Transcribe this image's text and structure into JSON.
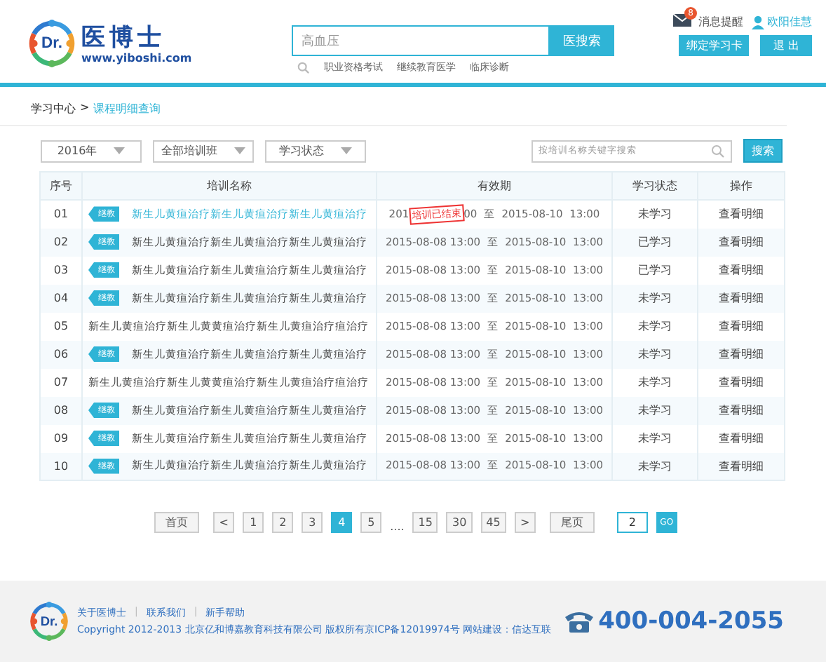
{
  "header": {
    "logo_mark": "Dr.",
    "logo_title": "医博士",
    "logo_url": "www.yiboshi.com",
    "search": {
      "value": "高血压",
      "button": "医搜索",
      "hot_words": [
        "职业资格考试",
        "继续教育医学",
        "临床诊断"
      ]
    },
    "messages": {
      "label": "消息提醒",
      "badge": "8"
    },
    "user": "欧阳佳慧",
    "bind_button": "绑定学习卡",
    "logout_button": "退 出"
  },
  "breadcrumb": {
    "root": "学习中心",
    "sep": ">",
    "current": "课程明细查询"
  },
  "filters": [
    {
      "label": "2016年"
    },
    {
      "label": "全部培训班"
    },
    {
      "label": "学习状态"
    }
  ],
  "keyword_search": {
    "placeholder": "按培训名称关键字搜索",
    "button": "搜索"
  },
  "table": {
    "columns": [
      "序号",
      "培训名称",
      "有效期",
      "学习状态",
      "操作"
    ],
    "rows": [
      {
        "no": "01",
        "tag": "继教",
        "name": "新生儿黄疸治疗新生儿黄疸治疗新生儿黄疸治疗",
        "selected": true,
        "valid_from": "201",
        "stamp": "培训已结束",
        "valid_from_rest": "00",
        "to": "至",
        "valid_until": "2015-08-10  13:00",
        "status": "未学习",
        "action": "查看明细"
      },
      {
        "no": "02",
        "tag": "继教",
        "name": "新生儿黄疸治疗新生儿黄疸治疗新生儿黄疸治疗",
        "selected": false,
        "valid_from": "2015-08-08  13:00",
        "to": "至",
        "valid_until": "2015-08-10  13:00",
        "status": "已学习",
        "action": "查看明细"
      },
      {
        "no": "03",
        "tag": "继教",
        "name": "新生儿黄疸治疗新生儿黄疸治疗新生儿黄疸治疗",
        "selected": false,
        "valid_from": "2015-08-08  13:00",
        "to": "至",
        "valid_until": "2015-08-10  13:00",
        "status": "已学习",
        "action": "查看明细"
      },
      {
        "no": "04",
        "tag": "继教",
        "name": "新生儿黄疸治疗新生儿黄疸治疗新生儿黄疸治疗",
        "selected": false,
        "valid_from": "2015-08-08  13:00",
        "to": "至",
        "valid_until": "2015-08-10  13:00",
        "status": "未学习",
        "action": "查看明细"
      },
      {
        "no": "05",
        "name": "新生儿黄疸治疗新生儿黄黄疸治疗新生儿黄疸治疗疸治疗",
        "selected": false,
        "valid_from": "2015-08-08  13:00",
        "to": "至",
        "valid_until": "2015-08-10  13:00",
        "status": "未学习",
        "action": "查看明细"
      },
      {
        "no": "06",
        "tag": "继教",
        "name": "新生儿黄疸治疗新生儿黄疸治疗新生儿黄疸治疗",
        "selected": false,
        "valid_from": "2015-08-08  13:00",
        "to": "至",
        "valid_until": "2015-08-10  13:00",
        "status": "未学习",
        "action": "查看明细"
      },
      {
        "no": "07",
        "name": "新生儿黄疸治疗新生儿黄黄疸治疗新生儿黄疸治疗疸治疗",
        "selected": false,
        "valid_from": "2015-08-08  13:00",
        "to": "至",
        "valid_until": "2015-08-10  13:00",
        "status": "未学习",
        "action": "查看明细"
      },
      {
        "no": "08",
        "tag": "继教",
        "name": "新生儿黄疸治疗新生儿黄疸治疗新生儿黄疸治疗",
        "selected": false,
        "valid_from": "2015-08-08  13:00",
        "to": "至",
        "valid_until": "2015-08-10  13:00",
        "status": "未学习",
        "action": "查看明细"
      },
      {
        "no": "09",
        "tag": "继教",
        "name": "新生儿黄疸治疗新生儿黄疸治疗新生儿黄疸治疗",
        "selected": false,
        "valid_from": "2015-08-08  13:00",
        "to": "至",
        "valid_until": "2015-08-10  13:00",
        "status": "未学习",
        "action": "查看明细"
      },
      {
        "no": "10",
        "tag": "继教",
        "name": "新生儿黄疸治疗新生儿黄疸治疗新生儿黄疸治疗",
        "selected": false,
        "valid_from": "2015-08-08  13:00",
        "to": "至",
        "valid_until": "2015-08-10  13:00",
        "status": "未学习",
        "action": "查看明细"
      }
    ]
  },
  "pagination": {
    "first": "首页",
    "prev": "<",
    "pages": [
      {
        "label": "1",
        "selected": false
      },
      {
        "label": "2",
        "selected": false
      },
      {
        "label": "3",
        "selected": false
      },
      {
        "label": "4",
        "selected": true
      },
      {
        "label": "5",
        "selected": false
      }
    ],
    "ellipsis": "....",
    "more_pages": [
      {
        "label": "15",
        "selected": false
      },
      {
        "label": "30",
        "selected": false
      },
      {
        "label": "45",
        "selected": false
      }
    ],
    "next": ">",
    "last": "尾页",
    "goto_value": "2",
    "go": "GO"
  },
  "footer": {
    "links": [
      "关于医博士",
      "联系我们",
      "新手帮助"
    ],
    "separator": "|",
    "copyright": "Copyright   2012-2013 北京亿和博嘉教育科技有限公司 版权所有京ICP备12019974号 网站建设：信达互联",
    "phone": "400-004-2055",
    "logo_mark": "Dr."
  }
}
